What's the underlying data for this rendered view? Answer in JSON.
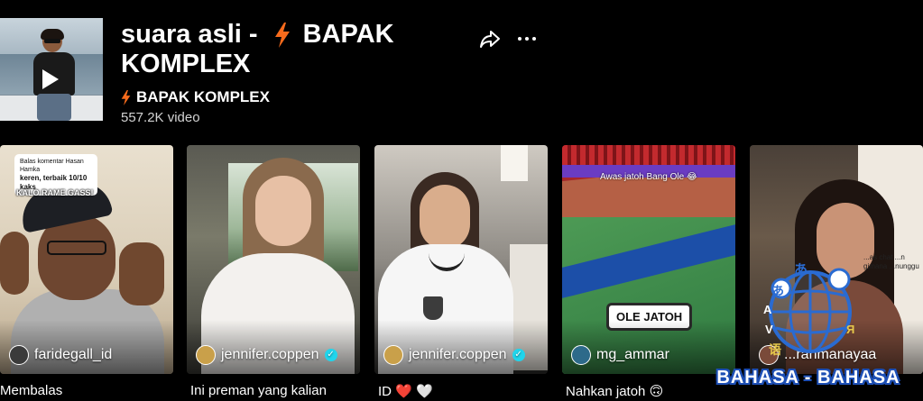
{
  "playlist": {
    "title_part1": "suara asli -",
    "title_part2": "BAPAK KOMPLEX",
    "author": "BAPAK KOMPLEX",
    "video_count": "557.2K video"
  },
  "colors": {
    "background": "#000000",
    "bolt": "#f76b1c",
    "verified": "#20d5ec"
  },
  "icons": {
    "share": "share-icon",
    "more": "more-icon",
    "play": "play-icon",
    "bolt": "lightning-bolt-icon"
  },
  "cards": [
    {
      "username": "faridegall_id",
      "verified": false,
      "caption": "Membalas",
      "reply_header": "Balas komentar Hasan Hamka",
      "reply_text": "keren, terbaik 10/10 kaks",
      "overlay": "KALO RAME GASS!"
    },
    {
      "username": "jennifer.coppen",
      "verified": true,
      "caption": "Ini preman yang kalian"
    },
    {
      "username": "jennifer.coppen",
      "verified": true,
      "caption": "ID ❤️ 🤍"
    },
    {
      "username": "mg_ammar",
      "verified": false,
      "caption": "Nahkan jatoh 🙃",
      "overlay_top": "Awas jatoh Bang Ole 😂",
      "overlay_label": "OLE JATOH"
    },
    {
      "username": "...rahmanayaa",
      "verified": false,
      "caption": "",
      "overlay_text": "...as chat ...n gimana ...nunggu"
    }
  ],
  "watermark": {
    "text": "BAHASA - BAHASA",
    "glyphs": [
      "あ",
      "あ",
      "A",
      "V",
      "Я",
      "语"
    ]
  }
}
